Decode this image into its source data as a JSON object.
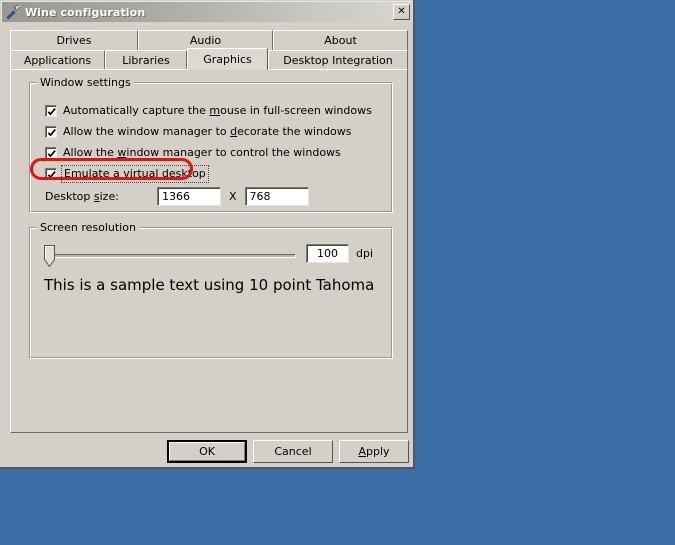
{
  "window": {
    "title": "Wine configuration",
    "icon": "wine-config-icon",
    "close_label": "✕"
  },
  "tabs": {
    "row_top": [
      {
        "label": "Drives",
        "selected": false
      },
      {
        "label": "Audio",
        "selected": false
      },
      {
        "label": "About",
        "selected": false
      }
    ],
    "row_bottom": [
      {
        "label": "Applications",
        "selected": false
      },
      {
        "label": "Libraries",
        "selected": false
      },
      {
        "label": "Graphics",
        "selected": true
      },
      {
        "label": "Desktop Integration",
        "selected": false
      }
    ]
  },
  "window_settings": {
    "group_title": "Window settings",
    "checkboxes": [
      {
        "label_before": "Automatically capture the ",
        "accel": "m",
        "label_after": "ouse in full-screen windows",
        "checked": true,
        "focused": false
      },
      {
        "label_before": "Allow the window manager to ",
        "accel": "d",
        "label_after": "ecorate the windows",
        "checked": true,
        "focused": false
      },
      {
        "label_before": "Allow the ",
        "accel": "w",
        "label_after": "indow manager to control the windows",
        "checked": true,
        "focused": false
      },
      {
        "label_before": "",
        "accel": "E",
        "label_after": "mulate a virtual desktop",
        "checked": true,
        "focused": true
      }
    ],
    "desktop_size": {
      "label_before": "Desktop ",
      "label_accel": "s",
      "label_after": "ize:",
      "width": "1366",
      "separator": "X",
      "height": "768"
    }
  },
  "screen_resolution": {
    "group_title": "Screen resolution",
    "dpi_value": "100",
    "dpi_unit": "dpi",
    "slider_position_percent": 0,
    "sample_text": "This is a sample text using 10 point Tahoma"
  },
  "buttons": {
    "ok": "OK",
    "cancel": "Cancel",
    "apply_before": "",
    "apply_accel": "A",
    "apply_after": "pply"
  },
  "annotation": {
    "type": "red-rounded-rect-highlight",
    "target": "Emulate a virtual desktop",
    "color": "#e8120f"
  },
  "colors": {
    "desktop_background": "#3b6ea5",
    "dialog_face": "#d4d0c8",
    "annotation_red": "#e8120f"
  }
}
